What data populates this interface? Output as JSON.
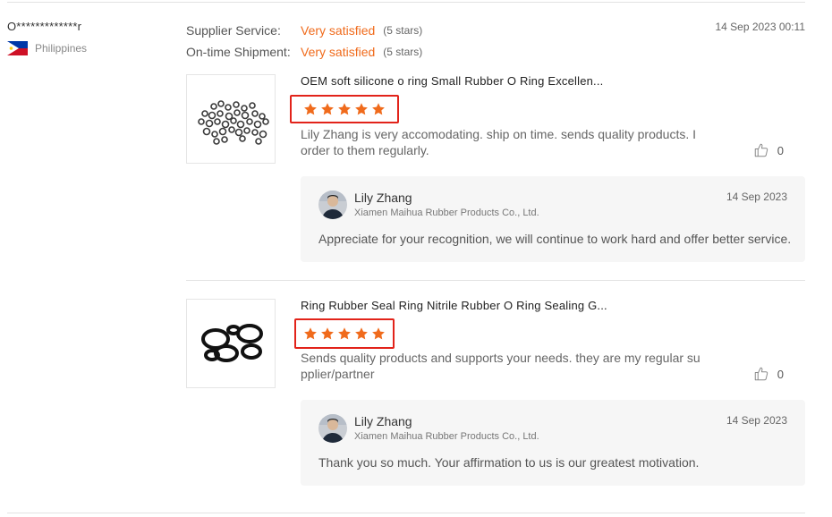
{
  "reviewer": {
    "name": "O*************r",
    "country": "Philippines"
  },
  "supplier_rating": {
    "label": "Supplier Service:",
    "value": "Very satisfied",
    "stars": "(5 stars)"
  },
  "shipment_rating": {
    "label": "On-time Shipment:",
    "value": "Very satisfied",
    "stars": "(5 stars)"
  },
  "review_date": "14 Sep 2023 00:11",
  "colors": {
    "accent": "#f06b1c",
    "highlight_box": "#e2231a",
    "reply_bg": "#f6f6f6"
  },
  "reviews": [
    {
      "title": "OEM soft silicone o ring Small Rubber O Ring Excellen...",
      "rating": 5,
      "comment": "Lily Zhang is very accomodating. ship on time. sends quality products. I order to them regularly.",
      "likes": "0",
      "reply": {
        "name": "Lily Zhang",
        "company": "Xiamen Maihua Rubber Products Co., Ltd.",
        "date": "14 Sep 2023",
        "text": "Appreciate for your recognition, we will continue to work hard and offer better service."
      }
    },
    {
      "title": "Ring Rubber Seal Ring Nitrile Rubber O Ring Sealing G...",
      "rating": 5,
      "comment": "Sends quality products and supports your needs. they are my regular supplier/partner",
      "likes": "0",
      "reply": {
        "name": "Lily Zhang",
        "company": "Xiamen Maihua Rubber Products Co., Ltd.",
        "date": "14 Sep 2023",
        "text": "Thank you so much. Your affirmation to us is our greatest motivation."
      }
    }
  ]
}
